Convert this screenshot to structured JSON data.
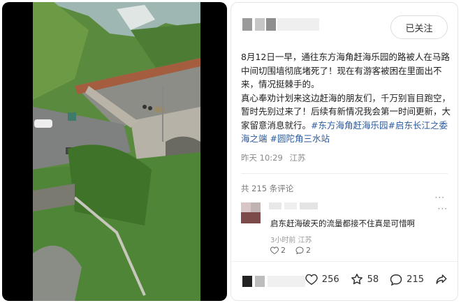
{
  "post": {
    "follow_label": "已关注",
    "body_line1": "8月12日一早，通往东方海角赶海乐园的路被人在马路中间切围墙彻底堵死了！现在有游客被困在里面出不来，情况挺棘手的。",
    "body_line2": "真心奉劝计划来这边赶海的朋友们，千万别盲目跑空，暂时先别过来了！后续有新情况我会第一时间更新，大家留意消息就行。",
    "tag1": "#东方海角赶海乐园",
    "tag2": "#启东长江之委海之端",
    "tag3": "#圆陀角三水站",
    "time": "昨天 10:29",
    "location": "江苏"
  },
  "comments": {
    "count_label": "共 215 条评论",
    "items": [
      {
        "text": "启东赶海破天的流量都接不住真是可惜啊",
        "time": "3小时前",
        "location": "江苏",
        "likes": "2",
        "replies": "2"
      }
    ]
  },
  "actions": {
    "likes": "256",
    "favorites": "58",
    "comments": "215"
  },
  "icons": {
    "like": "heart-icon",
    "favorite": "star-icon",
    "comment": "comment-bubble-icon",
    "share": "share-icon",
    "more": "more-dots-icon"
  },
  "colors": {
    "tag": "#2b5a9e",
    "muted": "#8a8a8a"
  }
}
